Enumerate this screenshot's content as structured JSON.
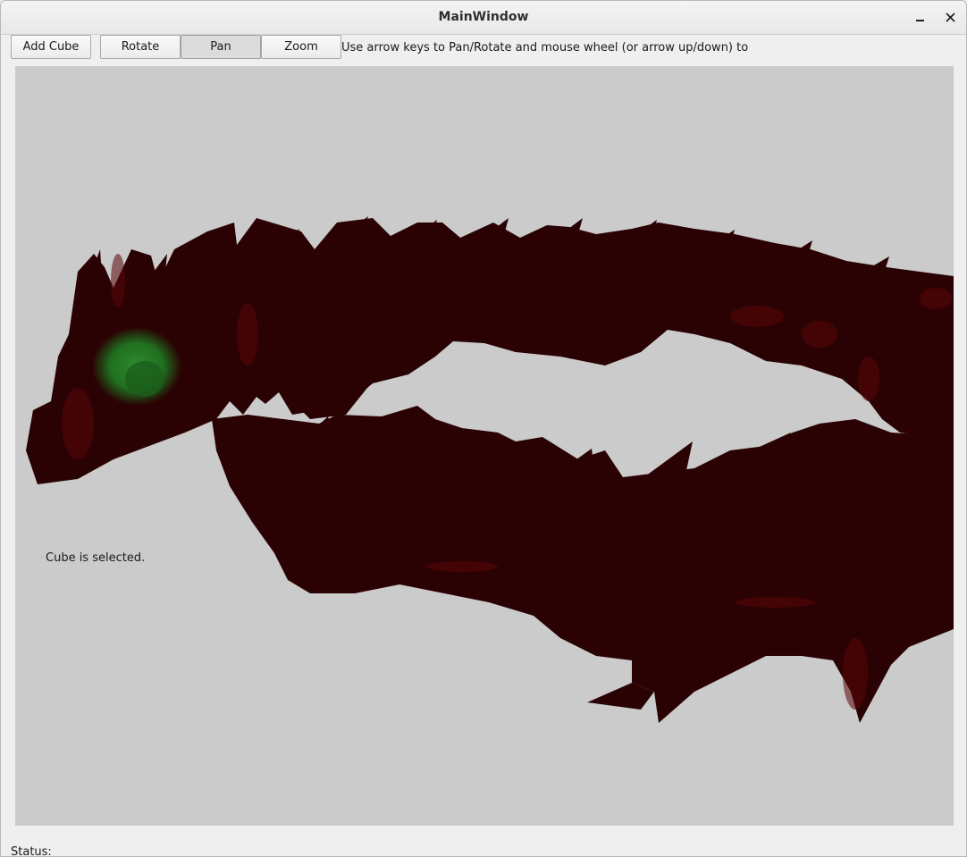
{
  "window": {
    "title": "MainWindow",
    "minimize_icon": "minimize-icon",
    "close_icon": "close-icon"
  },
  "toolbar": {
    "add_cube_label": "Add Cube",
    "rotate_label": "Rotate",
    "pan_label": "Pan",
    "zoom_label": "Zoom",
    "active_mode": "Pan",
    "hint": "Use arrow keys to Pan/Rotate and mouse wheel (or arrow up/down) to"
  },
  "viewport": {
    "selection_text": "Cube is selected.",
    "background_color": "#cbcbcb",
    "model_color": "#2a0203",
    "highlight_color": "#6a0a0a",
    "selection_color": "#1f6f1f"
  },
  "statusbar": {
    "label": "Status:"
  }
}
